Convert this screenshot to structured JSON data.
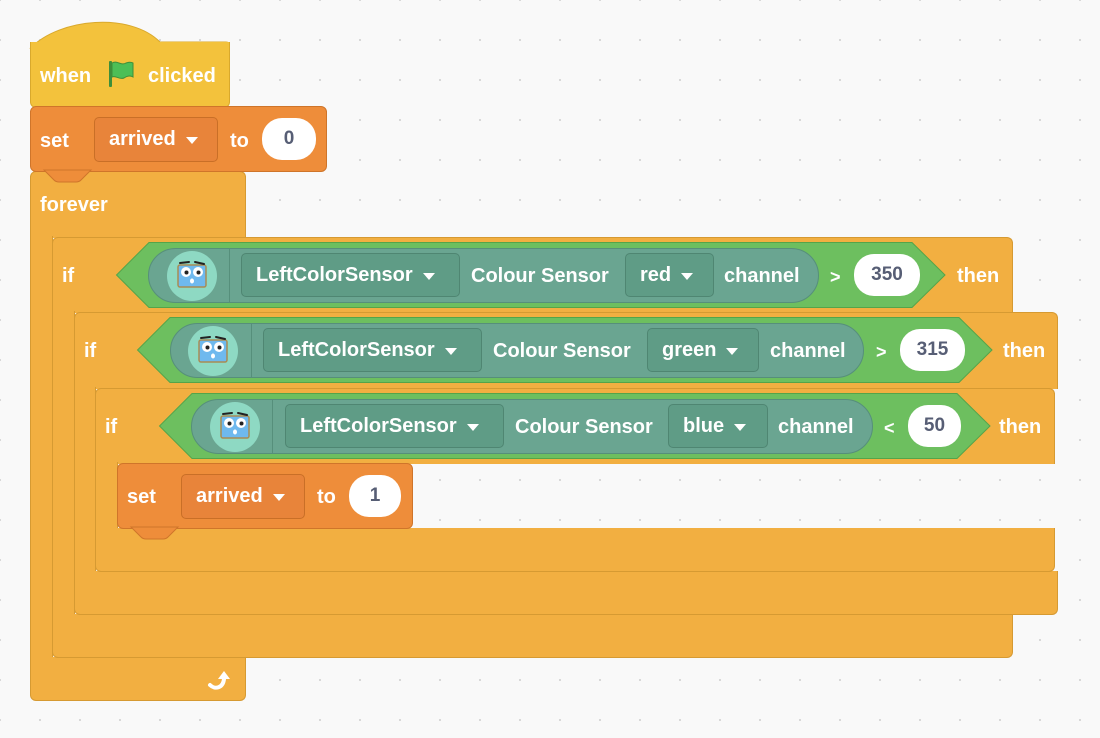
{
  "script": {
    "hat": {
      "when": "when",
      "clicked": "clicked",
      "flag_icon": "green-flag-icon"
    },
    "set_initial": {
      "set": "set",
      "variable": "arrived",
      "to": "to",
      "value": "0"
    },
    "forever": {
      "label": "forever",
      "loop_icon": "loop-arrow-icon"
    },
    "conditions": [
      {
        "if": "if",
        "sensor": "LeftColorSensor",
        "sensor_label": "Colour Sensor",
        "channel": "red",
        "channel_label": "channel",
        "operator": ">",
        "value": "350",
        "then": "then"
      },
      {
        "if": "if",
        "sensor": "LeftColorSensor",
        "sensor_label": "Colour Sensor",
        "channel": "green",
        "channel_label": "channel",
        "operator": ">",
        "value": "315",
        "then": "then"
      },
      {
        "if": "if",
        "sensor": "LeftColorSensor",
        "sensor_label": "Colour Sensor",
        "channel": "blue",
        "channel_label": "channel",
        "operator": "<",
        "value": "50",
        "then": "then"
      }
    ],
    "set_inner": {
      "set": "set",
      "variable": "arrived",
      "to": "to",
      "value": "1"
    }
  },
  "colors": {
    "events": "#f3c23c",
    "control": "#f2af41",
    "variables": "#ee8d3a",
    "operators": "#6dbf5f",
    "sensor": "#6aa591"
  }
}
